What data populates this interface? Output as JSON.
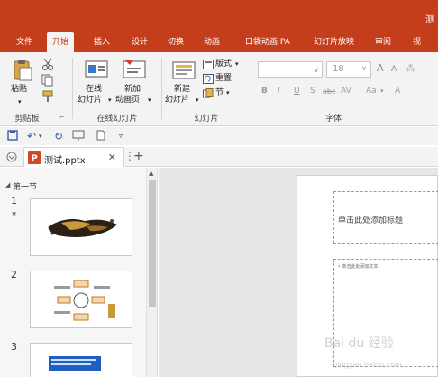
{
  "titlebar": {
    "title_fragment": "测"
  },
  "tabs": [
    "文件",
    "开始",
    "插入",
    "设计",
    "切换",
    "动画",
    "口袋动画 PA",
    "幻灯片放映",
    "审阅",
    "视"
  ],
  "active_tab_index": 1,
  "ribbon": {
    "clipboard": {
      "paste_label": "粘贴",
      "group_label": "剪贴板"
    },
    "online_slides": {
      "online_label_1": "在线",
      "online_label_2": "幻灯片",
      "new_anim_label_1": "新加",
      "new_anim_label_2": "动画页",
      "group_label": "在线幻灯片"
    },
    "slides": {
      "new_slide_label_1": "新建",
      "new_slide_label_2": "幻灯片",
      "layout_label": "版式",
      "reset_label": "重置",
      "section_label": "节",
      "group_label": "幻灯片"
    },
    "font": {
      "font_size": "18",
      "grow": "A",
      "shrink": "A",
      "bold": "B",
      "italic": "I",
      "underline": "U",
      "shadow": "S",
      "strike": "abc",
      "spacing": "AV",
      "case": "Aa",
      "color": "A",
      "group_label": "字体"
    }
  },
  "document_tab": {
    "name": "测试.pptx",
    "close": "✕"
  },
  "thumbnails": {
    "section_title": "第一节",
    "slide_numbers": [
      "1",
      "2",
      "3"
    ]
  },
  "slide": {
    "title_placeholder": "单击此处添加标题",
    "body_placeholder": "• 单击此处添加文本"
  },
  "watermark": {
    "line1": "Bai du 经验",
    "line2": "jingyan.baidu.com"
  },
  "colors": {
    "accent": "#c43e1c",
    "ribbon_bg": "#f3f3f3"
  }
}
